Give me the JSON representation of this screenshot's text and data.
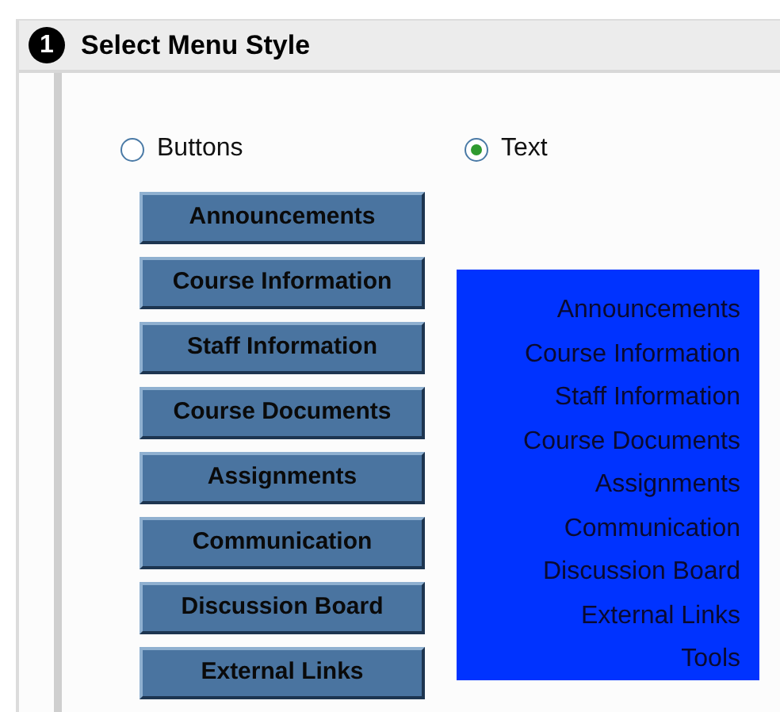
{
  "section": {
    "step": "1",
    "title": "Select Menu Style"
  },
  "options": [
    {
      "label": "Buttons",
      "selected": false
    },
    {
      "label": "Text",
      "selected": true
    }
  ],
  "button_menu": [
    "Announcements",
    "Course Information",
    "Staff Information",
    "Course Documents",
    "Assignments",
    "Communication",
    "Discussion Board",
    "External Links"
  ],
  "text_menu": [
    "Announcements",
    "Course Information",
    "Staff Information",
    "Course Documents",
    "Assignments",
    "Communication",
    "Discussion Board",
    "External Links",
    "Tools"
  ]
}
